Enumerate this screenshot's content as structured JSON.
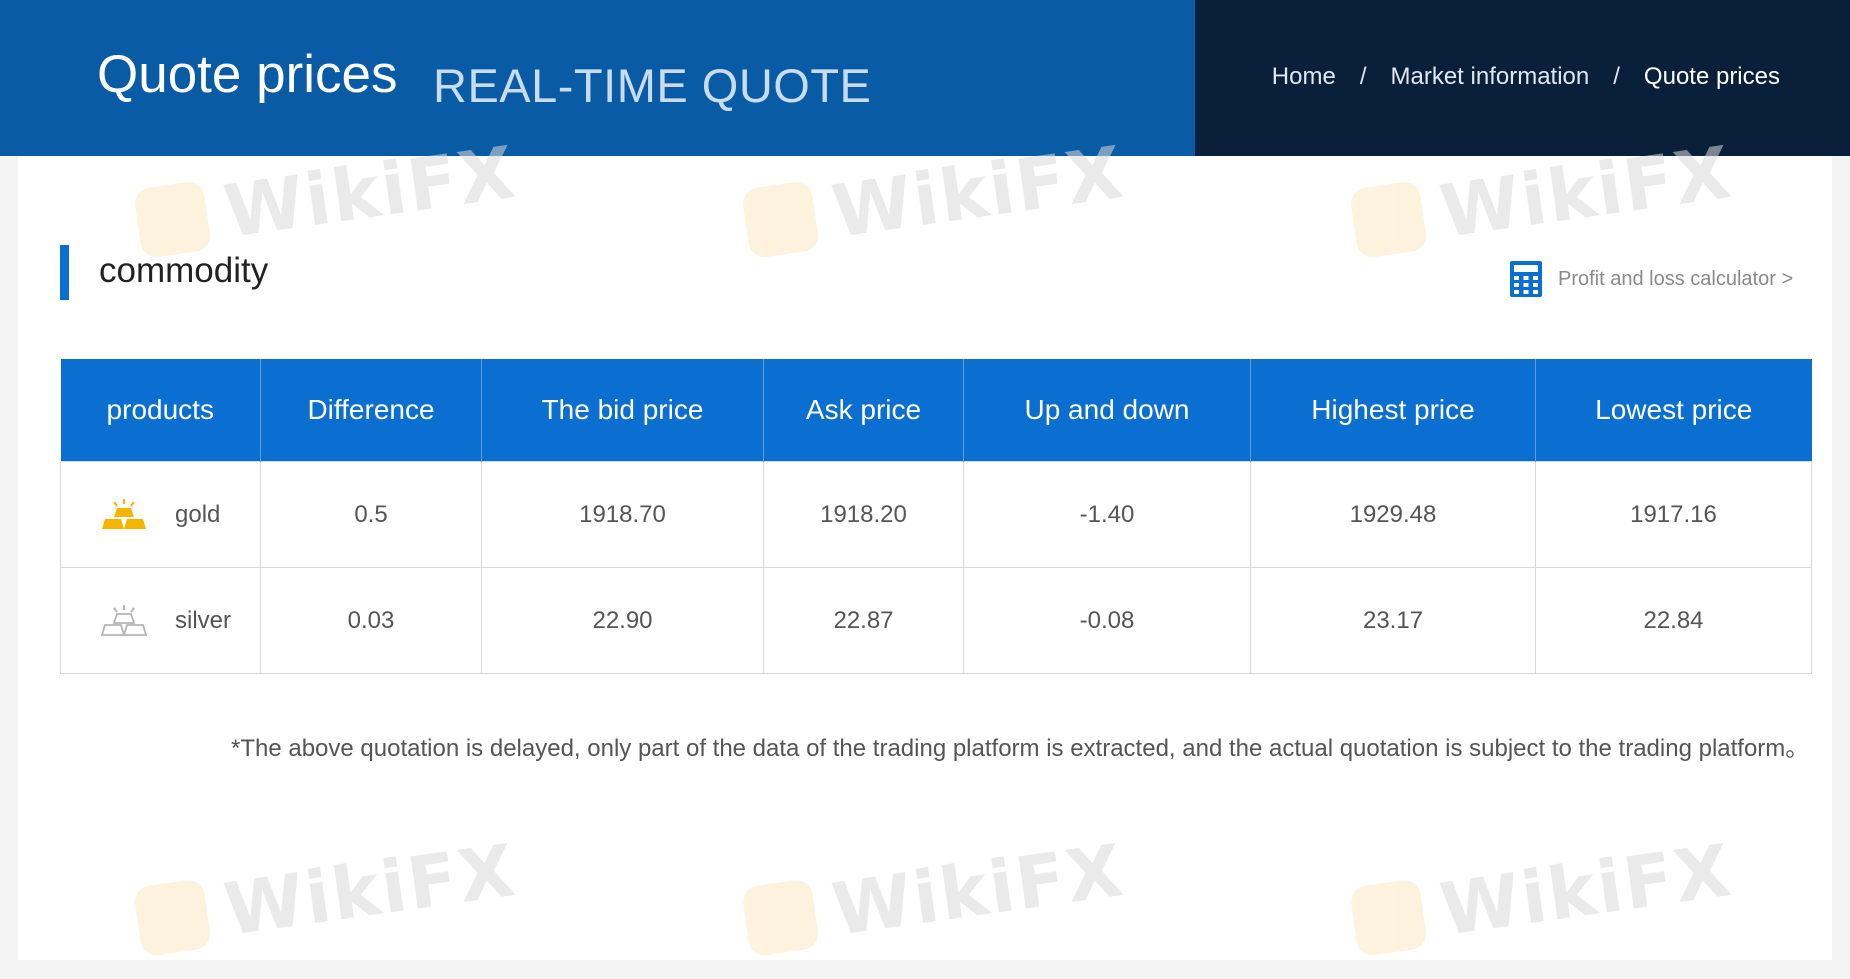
{
  "header": {
    "title": "Quote prices",
    "subtitle": "REAL-TIME QUOTE",
    "breadcrumb": [
      {
        "label": "Home"
      },
      {
        "label": "Market information"
      },
      {
        "label": "Quote prices"
      }
    ],
    "separator": "/"
  },
  "section": {
    "title": "commodity",
    "calculator_label": "Profit and loss calculator  >"
  },
  "table": {
    "headers": [
      "products",
      "Difference",
      "The bid price",
      "Ask price",
      "Up and down",
      "Highest price",
      "Lowest price"
    ],
    "rows": [
      {
        "product": "gold",
        "icon": "gold-bars-icon",
        "difference": "0.5",
        "bid": "1918.70",
        "ask": "1918.20",
        "change": "-1.40",
        "high": "1929.48",
        "low": "1917.16"
      },
      {
        "product": "silver",
        "icon": "silver-bars-icon",
        "difference": "0.03",
        "bid": "22.90",
        "ask": "22.87",
        "change": "-0.08",
        "high": "23.17",
        "low": "22.84"
      }
    ]
  },
  "note": "*The above quotation is delayed, only part of the data of the trading platform is extracted, and the actual quotation is subject to the trading platform。",
  "watermark": "WikiFX",
  "colors": {
    "header_blue": "#0a5ba5",
    "header_dark": "#0a1f3a",
    "table_header": "#0a6fd0",
    "price_red": "#c0313a",
    "gold": "#f4b400"
  }
}
